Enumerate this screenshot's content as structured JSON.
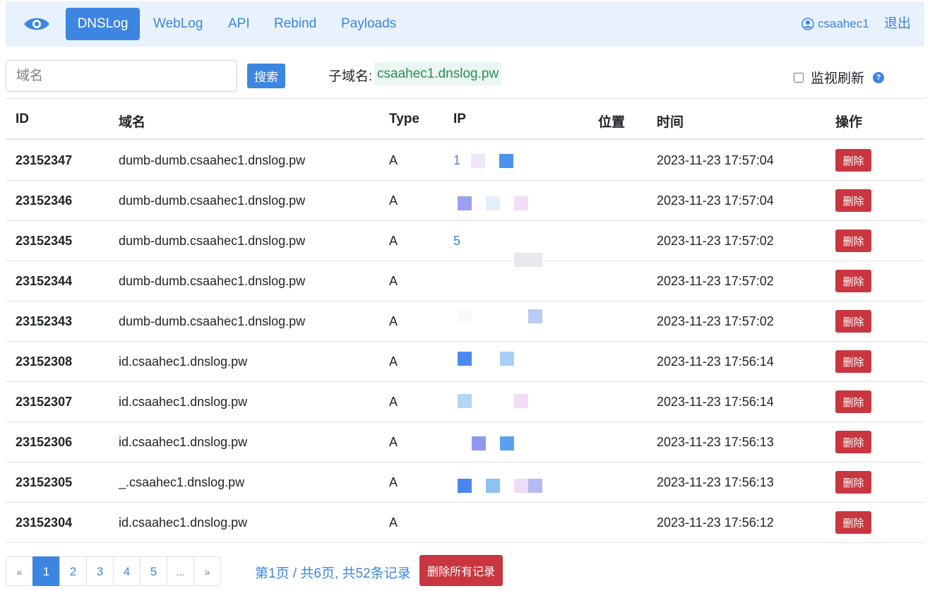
{
  "navbar": {
    "logo_icon": "eye-icon",
    "tabs": [
      {
        "label": "DNSLog",
        "active": true
      },
      {
        "label": "WebLog",
        "active": false
      },
      {
        "label": "API",
        "active": false
      },
      {
        "label": "Rebind",
        "active": false
      },
      {
        "label": "Payloads",
        "active": false
      }
    ],
    "username": "csaahec1",
    "logout_label": "退出"
  },
  "search": {
    "placeholder": "域名",
    "button_label": "搜索",
    "subdomain_label": "子域名:",
    "subdomain_value": "csaahec1.dnslog.pw",
    "monitor_label": "监视刷新",
    "monitor_checked": false
  },
  "table": {
    "headers": {
      "id": "ID",
      "domain": "域名",
      "type": "Type",
      "ip": "IP",
      "location": "位置",
      "time": "时间",
      "action": "操作"
    },
    "delete_label": "删除",
    "rows": [
      {
        "id": "23152347",
        "domain": "dumb-dumb.csaahec1.dnslog.pw",
        "type": "A",
        "ip": "1",
        "time": "2023-11-23 17:57:04"
      },
      {
        "id": "23152346",
        "domain": "dumb-dumb.csaahec1.dnslog.pw",
        "type": "A",
        "ip": "",
        "time": "2023-11-23 17:57:04"
      },
      {
        "id": "23152345",
        "domain": "dumb-dumb.csaahec1.dnslog.pw",
        "type": "A",
        "ip": "5",
        "time": "2023-11-23 17:57:02"
      },
      {
        "id": "23152344",
        "domain": "dumb-dumb.csaahec1.dnslog.pw",
        "type": "A",
        "ip": "",
        "time": "2023-11-23 17:57:02"
      },
      {
        "id": "23152343",
        "domain": "dumb-dumb.csaahec1.dnslog.pw",
        "type": "A",
        "ip": "",
        "time": "2023-11-23 17:57:02"
      },
      {
        "id": "23152308",
        "domain": "id.csaahec1.dnslog.pw",
        "type": "A",
        "ip": "",
        "time": "2023-11-23 17:56:14"
      },
      {
        "id": "23152307",
        "domain": "id.csaahec1.dnslog.pw",
        "type": "A",
        "ip": "",
        "time": "2023-11-23 17:56:14"
      },
      {
        "id": "23152306",
        "domain": "id.csaahec1.dnslog.pw",
        "type": "A",
        "ip": "",
        "time": "2023-11-23 17:56:13"
      },
      {
        "id": "23152305",
        "domain": "_.csaahec1.dnslog.pw",
        "type": "A",
        "ip": "",
        "time": "2023-11-23 17:56:13"
      },
      {
        "id": "23152304",
        "domain": "id.csaahec1.dnslog.pw",
        "type": "A",
        "ip": "",
        "time": "2023-11-23 17:56:12"
      }
    ]
  },
  "pagination": {
    "prev": "«",
    "pages": [
      "1",
      "2",
      "3",
      "4",
      "5",
      "..."
    ],
    "current": "1",
    "next": "»",
    "info": "第1页 / 共6页, 共52条记录",
    "delete_all_label": "删除所有记录"
  },
  "colors": {
    "primary": "#3d85e0",
    "danger": "#c9363f",
    "navbar_bg": "#e8f2fc",
    "subdomain_bg": "#eaf6f0",
    "subdomain_text": "#2e8b57"
  }
}
